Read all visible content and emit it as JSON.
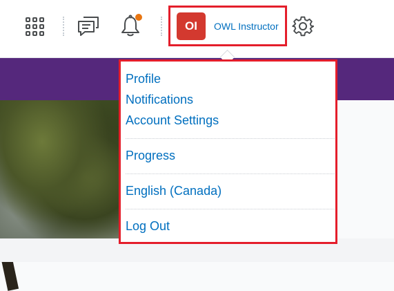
{
  "topbar": {
    "icons": {
      "apps": "waffle-grid-icon",
      "messages": "chat-bubble-icon",
      "notifications": "bell-icon",
      "settings": "gear-icon"
    },
    "user": {
      "initials": "OI",
      "name": "OWL Instructor"
    }
  },
  "menu": {
    "profile": "Profile",
    "notifications": "Notifications",
    "account_settings": "Account Settings",
    "progress": "Progress",
    "language": "English (Canada)",
    "logout": "Log Out"
  },
  "colors": {
    "accent_link": "#006fbf",
    "banner": "#55287c",
    "avatar": "#d3392f",
    "highlight": "#e41e2b",
    "notification_dot": "#e87511"
  }
}
